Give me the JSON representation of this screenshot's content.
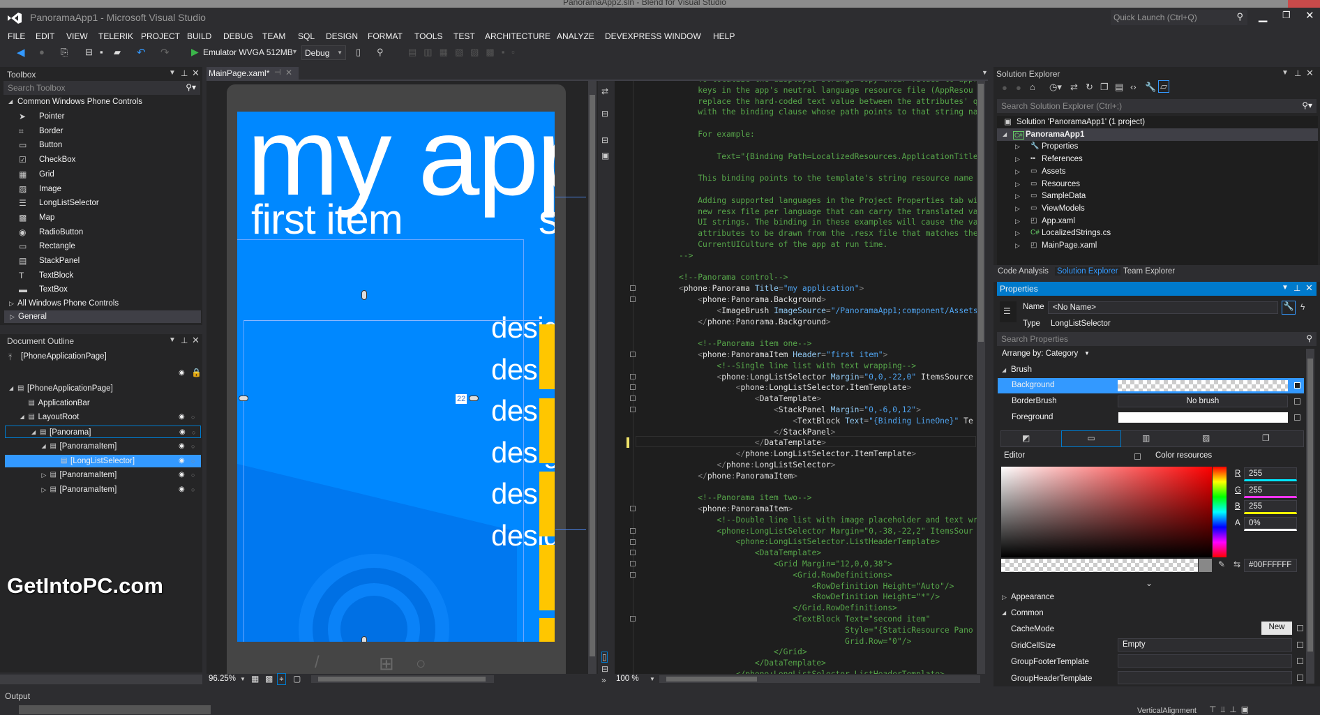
{
  "background_window": {
    "title": "PanoramaApp2.sln - Blend for Visual Studio"
  },
  "window": {
    "title": "PanoramaApp1 - Microsoft Visual Studio",
    "quick_launch_placeholder": "Quick Launch (Ctrl+Q)"
  },
  "menu": [
    "FILE",
    "EDIT",
    "VIEW",
    "TELERIK",
    "PROJECT",
    "BUILD",
    "DEBUG",
    "TEAM",
    "SQL",
    "DESIGN",
    "FORMAT",
    "TOOLS",
    "TEST",
    "ARCHITECTURE",
    "ANALYZE",
    "DEVEXPRESS",
    "WINDOW",
    "HELP"
  ],
  "toolbar": {
    "run_target": "Emulator WVGA 512MB",
    "configuration": "Debug"
  },
  "toolbox": {
    "title": "Toolbox",
    "search_placeholder": "Search Toolbox",
    "category": "Common Windows Phone Controls",
    "items": [
      {
        "label": "Pointer",
        "icon": "pointer-icon",
        "glyph": "➤"
      },
      {
        "label": "Border",
        "icon": "border-icon",
        "glyph": "⌗"
      },
      {
        "label": "Button",
        "icon": "button-icon",
        "glyph": "▭"
      },
      {
        "label": "CheckBox",
        "icon": "checkbox-icon",
        "glyph": "☑"
      },
      {
        "label": "Grid",
        "icon": "grid-icon",
        "glyph": "▦"
      },
      {
        "label": "Image",
        "icon": "image-icon",
        "glyph": "▨"
      },
      {
        "label": "LongListSelector",
        "icon": "list-icon",
        "glyph": "☰"
      },
      {
        "label": "Map",
        "icon": "map-icon",
        "glyph": "▩"
      },
      {
        "label": "RadioButton",
        "icon": "radio-icon",
        "glyph": "◉"
      },
      {
        "label": "Rectangle",
        "icon": "rectangle-icon",
        "glyph": "▭"
      },
      {
        "label": "StackPanel",
        "icon": "stackpanel-icon",
        "glyph": "▤"
      },
      {
        "label": "TextBlock",
        "icon": "textblock-icon",
        "glyph": "T"
      },
      {
        "label": "TextBox",
        "icon": "textbox-icon",
        "glyph": "▬"
      }
    ],
    "other_categories": [
      "All Windows Phone Controls",
      "General"
    ]
  },
  "document_outline": {
    "title": "Document Outline",
    "root": "[PhoneApplicationPage]",
    "items": [
      {
        "label": "[PhoneApplicationPage]",
        "depth": 0,
        "arrow": "expanded",
        "eye": false
      },
      {
        "label": "ApplicationBar",
        "depth": 1,
        "arrow": "none",
        "eye": false
      },
      {
        "label": "LayoutRoot",
        "depth": 1,
        "arrow": "expanded",
        "eye": true
      },
      {
        "label": "[Panorama]",
        "depth": 2,
        "arrow": "expanded",
        "eye": true,
        "outlined": true
      },
      {
        "label": "[PanoramaItem]",
        "depth": 3,
        "arrow": "expanded",
        "eye": true
      },
      {
        "label": "[LongListSelector]",
        "depth": 4,
        "arrow": "none",
        "eye": true,
        "selected": true
      },
      {
        "label": "[PanoramaItem]",
        "depth": 3,
        "arrow": "collapsed",
        "eye": true
      },
      {
        "label": "[PanoramaItem]",
        "depth": 3,
        "arrow": "collapsed",
        "eye": true
      }
    ]
  },
  "editor_tab": {
    "label": "MainPage.xaml*"
  },
  "designer": {
    "app_title": "my application",
    "panorama_header": "first item",
    "second_header": "second item",
    "list_items": [
      "design one",
      "design two",
      "design three",
      "design four",
      "design five",
      "design six"
    ],
    "margin_label": "22",
    "zoom": "96.25%"
  },
  "code_editor": {
    "zoom": "100 %",
    "lines": [
      "    To localize the displayed strings copy their values to appr",
      "    keys in the app's neutral language resource file (AppResou",
      "    replace the hard-coded text value between the attributes' q",
      "    with the binding clause whose path points to that string na",
      "",
      "    For example:",
      "",
      "        Text=\"{Binding Path=LocalizedResources.ApplicationTitle",
      "",
      "    This binding points to the template's string resource name",
      "",
      "    Adding supported languages in the Project Properties tab wi",
      "    new resx file per language that can carry the translated va",
      "    UI strings. The binding in these examples will cause the va",
      "    attributes to be drawn from the .resx file that matches the",
      "    CurrentUICulture of the app at run time.",
      "-->",
      "",
      "<!--Panorama control-->",
      "<phone:Panorama Title=\"my application\">",
      "    <phone:Panorama.Background>",
      "        <ImageBrush ImageSource=\"/PanoramaApp1;component/Assets",
      "    </phone:Panorama.Background>",
      "",
      "    <!--Panorama item one-->",
      "    <phone:PanoramaItem Header=\"first item\">",
      "        <!--Single line list with text wrapping-->",
      "        <phone:LongListSelector Margin=\"0,0,-22,0\" ItemsSource",
      "            <phone:LongListSelector.ItemTemplate>",
      "                <DataTemplate>",
      "                    <StackPanel Margin=\"0,-6,0,12\">",
      "                        <TextBlock Text=\"{Binding LineOne}\" Te",
      "                    </StackPanel>",
      "                </DataTemplate>",
      "            </phone:LongListSelector.ItemTemplate>",
      "        </phone:LongListSelector>",
      "    </phone:PanoramaItem>",
      "",
      "    <!--Panorama item two-->",
      "    <phone:PanoramaItem>",
      "        <!--Double line list with image placeholder and text wr",
      "        <phone:LongListSelector Margin=\"0,-38,-22,2\" ItemsSour",
      "            <phone:LongListSelector.ListHeaderTemplate>",
      "                <DataTemplate>",
      "                    <Grid Margin=\"12,0,0,38\">",
      "                        <Grid.RowDefinitions>",
      "                            <RowDefinition Height=\"Auto\"/>",
      "                            <RowDefinition Height=\"*\"/>",
      "                        </Grid.RowDefinitions>",
      "                        <TextBlock Text=\"second item\"",
      "                                   Style=\"{StaticResource Pano",
      "                                   Grid.Row=\"0\"/>",
      "                    </Grid>",
      "                </DataTemplate>",
      "            </phone:LongListSelector.ListHeaderTemplate>"
    ]
  },
  "solution_explorer": {
    "title": "Solution Explorer",
    "search_placeholder": "Search Solution Explorer (Ctrl+;)",
    "solution": "Solution 'PanoramaApp1' (1 project)",
    "project": "PanoramaApp1",
    "items": [
      {
        "label": "Properties",
        "icon": "wrench-icon",
        "glyph": "🔧"
      },
      {
        "label": "References",
        "icon": "references-icon",
        "glyph": "▪▪"
      },
      {
        "label": "Assets",
        "icon": "folder-icon",
        "glyph": "▭"
      },
      {
        "label": "Resources",
        "icon": "folder-icon",
        "glyph": "▭"
      },
      {
        "label": "SampleData",
        "icon": "folder-icon",
        "glyph": "▭"
      },
      {
        "label": "ViewModels",
        "icon": "folder-icon",
        "glyph": "▭"
      },
      {
        "label": "App.xaml",
        "icon": "xaml-file-icon",
        "glyph": "◰"
      },
      {
        "label": "LocalizedStrings.cs",
        "icon": "csharp-file-icon",
        "glyph": "C#"
      },
      {
        "label": "MainPage.xaml",
        "icon": "xaml-file-icon",
        "glyph": "◰"
      }
    ]
  },
  "bottom_tabs": [
    {
      "label": "Code Analysis",
      "active": false
    },
    {
      "label": "Solution Explorer",
      "active": true
    },
    {
      "label": "Team Explorer",
      "active": false
    }
  ],
  "properties": {
    "title": "Properties",
    "name_label": "Name",
    "name_value": "<No Name>",
    "type_label": "Type",
    "type_value": "LongListSelector",
    "search_placeholder": "Search Properties",
    "arrange_by": "Arrange by: Category",
    "brush_category": "Brush",
    "brush_rows": [
      {
        "label": "Background",
        "value": "",
        "kind": "transparent",
        "selected": true
      },
      {
        "label": "BorderBrush",
        "value": "No brush",
        "kind": "none"
      },
      {
        "label": "Foreground",
        "value": "",
        "kind": "white"
      }
    ],
    "editor_label": "Editor",
    "color_resources_label": "Color resources",
    "rgba": [
      {
        "label": "R",
        "value": "255",
        "bar": "#00e5ff"
      },
      {
        "label": "G",
        "value": "255",
        "bar": "#ff33ff"
      },
      {
        "label": "B",
        "value": "255",
        "bar": "#ffff00"
      },
      {
        "label": "A",
        "value": "0%",
        "bar": "#ffffff"
      }
    ],
    "hex_value": "#00FFFFFF",
    "appearance_category": "Appearance",
    "common_category": "Common",
    "common_rows": [
      {
        "label": "CacheMode",
        "value": "New",
        "kind": "button"
      },
      {
        "label": "GridCellSize",
        "value": "Empty",
        "kind": "field"
      },
      {
        "label": "GroupFooterTemplate",
        "value": "",
        "kind": "field"
      },
      {
        "label": "GroupHeaderTemplate",
        "value": "",
        "kind": "field"
      }
    ]
  },
  "output": {
    "title": "Output"
  },
  "status": {
    "vertical_alignment_label": "VerticalAlignment"
  },
  "watermark": "GetIntoPC.com",
  "colors": {
    "accent": "#007acc",
    "selection": "#3399ff",
    "phone_blue": "#0088ff",
    "phone_accent": "#ffc600"
  }
}
